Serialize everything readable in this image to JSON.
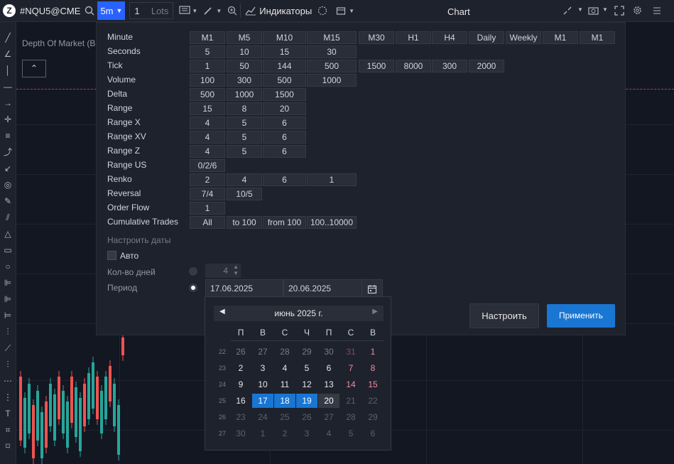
{
  "topbar": {
    "logo": "Z",
    "symbol": "#NQU5@CME",
    "timeframe": "5m",
    "lots_value": "1",
    "lots_label": "Lots",
    "indicators_label": "Индикаторы",
    "chart_title": "Chart"
  },
  "chart": {
    "dom_label": "Depth Of Market (B",
    "collapse_glyph": "⌃"
  },
  "panel": {
    "rows": [
      {
        "label": "Minute",
        "cells": [
          "M1",
          "M5",
          "M10",
          "M15",
          "M30",
          "H1",
          "H4",
          "Daily",
          "Weekly",
          "M1",
          "M1"
        ]
      },
      {
        "label": "Seconds",
        "cells": [
          "5",
          "10",
          "15",
          "30"
        ]
      },
      {
        "label": "Tick",
        "cells": [
          "1",
          "50",
          "144",
          "500",
          "1500",
          "8000",
          "300",
          "2000"
        ]
      },
      {
        "label": "Volume",
        "cells": [
          "100",
          "300",
          "500",
          "1000"
        ]
      },
      {
        "label": "Delta",
        "cells": [
          "500",
          "1000",
          "1500"
        ]
      },
      {
        "label": "Range",
        "cells": [
          "15",
          "8",
          "20"
        ]
      },
      {
        "label": "Range X",
        "cells": [
          "4",
          "5",
          "6"
        ]
      },
      {
        "label": "Range XV",
        "cells": [
          "4",
          "5",
          "6"
        ]
      },
      {
        "label": "Range Z",
        "cells": [
          "4",
          "5",
          "6"
        ]
      },
      {
        "label": "Range US",
        "cells": [
          "0/2/6"
        ]
      },
      {
        "label": "Renko",
        "cells": [
          "2",
          "4",
          "6",
          "1"
        ]
      },
      {
        "label": "Reversal",
        "cells": [
          "7/4",
          "10/5"
        ]
      },
      {
        "label": "Order Flow",
        "cells": [
          "1"
        ]
      },
      {
        "label": "Cumulative Trades",
        "cells": [
          "All",
          "to 100",
          "from 100",
          "100..10000"
        ]
      }
    ],
    "dates_section": "Настроить даты",
    "auto_label": "Авто",
    "days_label": "Кол-во дней",
    "days_value": "4",
    "period_label": "Период",
    "date_from": "17.06.2025",
    "date_to": "20.06.2025",
    "setup_button": "Настроить",
    "apply_button": "Применить"
  },
  "calendar": {
    "title": "июнь 2025 г.",
    "weekdays": [
      "П",
      "В",
      "С",
      "Ч",
      "П",
      "С",
      "В"
    ],
    "weeks": [
      {
        "num": "22",
        "days": [
          "26",
          "27",
          "28",
          "29",
          "30",
          "31",
          "1"
        ]
      },
      {
        "num": "23",
        "days": [
          "2",
          "3",
          "4",
          "5",
          "6",
          "7",
          "8"
        ]
      },
      {
        "num": "24",
        "days": [
          "9",
          "10",
          "11",
          "12",
          "13",
          "14",
          "15"
        ]
      },
      {
        "num": "25",
        "days": [
          "16",
          "17",
          "18",
          "19",
          "20",
          "21",
          "22"
        ]
      },
      {
        "num": "26",
        "days": [
          "23",
          "24",
          "25",
          "26",
          "27",
          "28",
          "29"
        ]
      },
      {
        "num": "27",
        "days": [
          "30",
          "1",
          "2",
          "3",
          "4",
          "5",
          "6"
        ]
      }
    ]
  },
  "colors": {
    "accent": "#2962ff",
    "selected": "#1976d2",
    "weekend": "#f28b9b",
    "muted": "#787b86"
  }
}
